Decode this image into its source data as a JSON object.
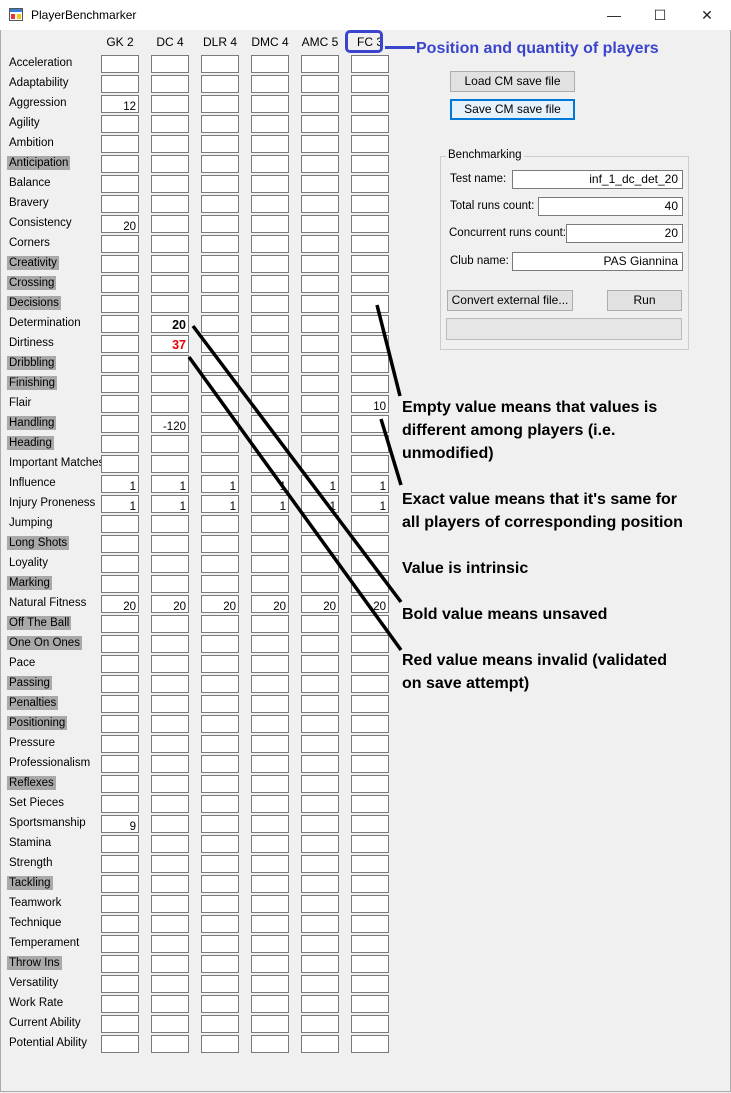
{
  "window": {
    "title": "PlayerBenchmarker",
    "minimize_label": "—",
    "maximize_label": "☐",
    "close_label": "✕"
  },
  "columns": [
    "GK 2",
    "DC 4",
    "DLR 4",
    "DMC 4",
    "AMC 5",
    "FC 3"
  ],
  "attributes": [
    "Acceleration",
    "Adaptability",
    "Aggression",
    "Agility",
    "Ambition",
    "Anticipation",
    "Balance",
    "Bravery",
    "Consistency",
    "Corners",
    "Creativity",
    "Crossing",
    "Decisions",
    "Determination",
    "Dirtiness",
    "Dribbling",
    "Finishing",
    "Flair",
    "Handling",
    "Heading",
    "Important Matches",
    "Influence",
    "Injury Proneness",
    "Jumping",
    "Long Shots",
    "Loyality",
    "Marking",
    "Natural Fitness",
    "Off The Ball",
    "One On Ones",
    "Pace",
    "Passing",
    "Penalties",
    "Positioning",
    "Pressure",
    "Professionalism",
    "Reflexes",
    "Set Pieces",
    "Sportsmanship",
    "Stamina",
    "Strength",
    "Tackling",
    "Teamwork",
    "Technique",
    "Temperament",
    "Throw Ins",
    "Versatility",
    "Work Rate",
    "Current Ability",
    "Potential Ability"
  ],
  "highlighted_attributes": [
    "Anticipation",
    "Creativity",
    "Crossing",
    "Decisions",
    "Dribbling",
    "Finishing",
    "Handling",
    "Heading",
    "Long Shots",
    "Marking",
    "Off The Ball",
    "One On Ones",
    "Passing",
    "Penalties",
    "Positioning",
    "Reflexes",
    "Tackling",
    "Throw Ins"
  ],
  "values": [
    {
      "row": 2,
      "col": 0,
      "value": "12"
    },
    {
      "row": 8,
      "col": 0,
      "value": "20"
    },
    {
      "row": 13,
      "col": 1,
      "value": "20",
      "bold": true
    },
    {
      "row": 14,
      "col": 1,
      "value": "37",
      "bold": true,
      "red": true
    },
    {
      "row": 17,
      "col": 5,
      "value": "10"
    },
    {
      "row": 18,
      "col": 1,
      "value": "-120"
    },
    {
      "row": 21,
      "col": 0,
      "value": "1"
    },
    {
      "row": 21,
      "col": 1,
      "value": "1"
    },
    {
      "row": 21,
      "col": 2,
      "value": "1"
    },
    {
      "row": 21,
      "col": 3,
      "value": "1"
    },
    {
      "row": 21,
      "col": 4,
      "value": "1"
    },
    {
      "row": 21,
      "col": 5,
      "value": "1"
    },
    {
      "row": 22,
      "col": 0,
      "value": "1"
    },
    {
      "row": 22,
      "col": 1,
      "value": "1"
    },
    {
      "row": 22,
      "col": 2,
      "value": "1"
    },
    {
      "row": 22,
      "col": 3,
      "value": "1"
    },
    {
      "row": 22,
      "col": 4,
      "value": "1"
    },
    {
      "row": 22,
      "col": 5,
      "value": "1"
    },
    {
      "row": 27,
      "col": 0,
      "value": "20"
    },
    {
      "row": 27,
      "col": 1,
      "value": "20"
    },
    {
      "row": 27,
      "col": 2,
      "value": "20"
    },
    {
      "row": 27,
      "col": 3,
      "value": "20"
    },
    {
      "row": 27,
      "col": 4,
      "value": "20"
    },
    {
      "row": 27,
      "col": 5,
      "value": "20"
    },
    {
      "row": 38,
      "col": 0,
      "value": "9"
    }
  ],
  "buttons": {
    "load": "Load CM save file",
    "save": "Save CM save file",
    "convert": "Convert external file...",
    "run": "Run"
  },
  "benchmarking": {
    "group_title": "Benchmarking",
    "test_name_label": "Test name:",
    "test_name_value": "inf_1_dc_det_20",
    "total_runs_label": "Total runs count:",
    "total_runs_value": "40",
    "concurrent_runs_label": "Concurrent runs count:",
    "concurrent_runs_value": "20",
    "club_name_label": "Club name:",
    "club_name_value": "PAS Giannina"
  },
  "annotations": {
    "position_quantity": "Position and quantity of players",
    "empty_value_1": "Empty value means that values is",
    "empty_value_2": "different among players (i.e.",
    "empty_value_3": "unmodified)",
    "exact_value_1": "Exact value means that it's same for",
    "exact_value_2": "all players of corresponding position",
    "intrinsic": "Value is intrinsic",
    "bold_unsaved": "Bold value means unsaved",
    "red_invalid_1": "Red value means invalid (validated",
    "red_invalid_2": "on save attempt)"
  },
  "colors": {
    "callout_blue": "#3b45cc",
    "invalid_red": "#e00000",
    "highlight_gray": "#a9a9a9"
  }
}
